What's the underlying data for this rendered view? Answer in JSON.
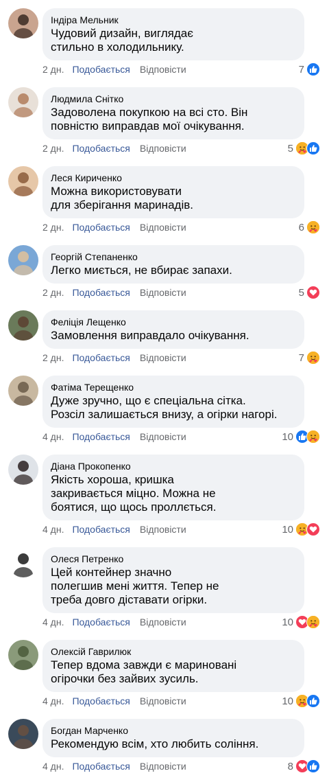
{
  "comments": [
    {
      "author": "Індіра Мельник",
      "text": "Чудовий дизайн, виглядає\nстильно в холодильнику.",
      "time": "2 дн.",
      "like": "Подобається",
      "reply": "Відповісти",
      "count": "7",
      "reactions": [
        "like-icon"
      ]
    },
    {
      "author": "Людмила Снітко",
      "text": "Задоволена покупкою на всі сто. Він\nповністю виправдав мої очікування.",
      "time": "2 дн.",
      "like": "Подобається",
      "reply": "Відповісти",
      "count": "5",
      "reactions": [
        "care-icon",
        "like-icon"
      ]
    },
    {
      "author": "Леся Кириченко",
      "text": "Можна використовувати\nдля зберігання маринадів.",
      "time": "2 дн.",
      "like": "Подобається",
      "reply": "Відповісти",
      "count": "6",
      "reactions": [
        "care-icon"
      ]
    },
    {
      "author": "Георгій Степаненко",
      "text": "Легко миється, не вбирає запахи.",
      "time": "2 дн.",
      "like": "Подобається",
      "reply": "Відповісти",
      "count": "5",
      "reactions": [
        "love-icon"
      ]
    },
    {
      "author": "Феліція Лещенко",
      "text": "Замовлення виправдало очікування.",
      "time": "2 дн.",
      "like": "Подобається",
      "reply": "Відповісти",
      "count": "7",
      "reactions": [
        "care-icon"
      ]
    },
    {
      "author": "Фатіма Терещенко",
      "text": "Дуже зручно, що є спеціальна сітка.\nРозсіл залишається внизу, а огірки нагорі.",
      "time": "4 дн.",
      "like": "Подобається",
      "reply": "Відповісти",
      "count": "10",
      "reactions": [
        "like-icon",
        "care-icon"
      ]
    },
    {
      "author": "Діана Прокопенко",
      "text": "Якість хороша, кришка\nзакривається міцно. Можна не\nбоятися, що щось проллється.",
      "time": "4 дн.",
      "like": "Подобається",
      "reply": "Відповісти",
      "count": "10",
      "reactions": [
        "care-icon",
        "love-icon"
      ]
    },
    {
      "author": "Олеся Петренко",
      "text": "Цей контейнер значно\nполегшив мені життя. Тепер не\nтреба довго діставати огірки.",
      "time": "4 дн.",
      "like": "Подобається",
      "reply": "Відповісти",
      "count": "10",
      "reactions": [
        "love-icon",
        "care-icon"
      ]
    },
    {
      "author": "Олексій Гаврилюк",
      "text": "Тепер вдома завжди є мариновані\nогірочки без зайвих зусиль.",
      "time": "4 дн.",
      "like": "Подобається",
      "reply": "Відповісти",
      "count": "10",
      "reactions": [
        "care-icon",
        "like-icon"
      ]
    },
    {
      "author": "Богдан Марченко",
      "text": "Рекомендую всім, хто любить соління.",
      "time": "4 дн.",
      "like": "Подобається",
      "reply": "Відповісти",
      "count": "8",
      "reactions": [
        "love-icon",
        "like-icon"
      ]
    }
  ],
  "colors": {
    "like_blue": "#1877f2",
    "love_red": "#f33e58",
    "care_yellow": "#f7b125",
    "link": "#385898",
    "meta": "#65676b",
    "bubble": "#f0f2f5"
  }
}
